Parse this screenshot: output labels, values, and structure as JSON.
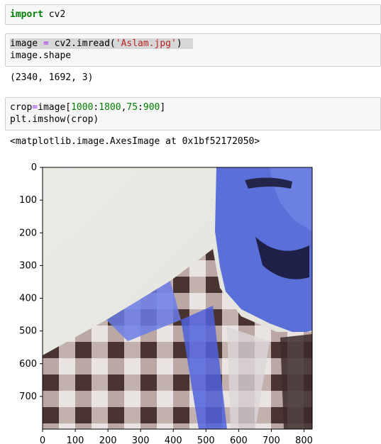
{
  "cells": [
    {
      "kw": "import",
      "rest": " cv2"
    },
    {
      "line1": {
        "var": "image",
        "eq": " = ",
        "call": "cv2.imread(",
        "str": "'Aslam.jpg'",
        "close": ")"
      },
      "line2": "image.shape"
    },
    {
      "line1": {
        "var": "crop",
        "eq": "=",
        "base": "image[",
        "n1": "1000",
        "c1": ":",
        "n2": "1800",
        "comma": ",",
        "n3": "75",
        "c2": ":",
        "n4": "900",
        "close": "]"
      },
      "line2": "plt.imshow(crop)"
    }
  ],
  "outputs": {
    "shape": "(2340, 1692, 3)",
    "axes_repr": "<matplotlib.image.AxesImage at 0x1bf52172050>"
  },
  "chart_data": {
    "type": "image",
    "xticks": [
      0,
      100,
      200,
      300,
      400,
      500,
      600,
      700,
      800
    ],
    "yticks": [
      0,
      100,
      200,
      300,
      400,
      500,
      600,
      700
    ],
    "xlim": [
      0,
      825
    ],
    "ylim": [
      800,
      0
    ],
    "image_description_kind": "photo"
  },
  "colors": {
    "cell_bg": "#f7f7f7",
    "keyword": "#008000",
    "string": "#ba2121",
    "operator": "#aa22ff"
  }
}
